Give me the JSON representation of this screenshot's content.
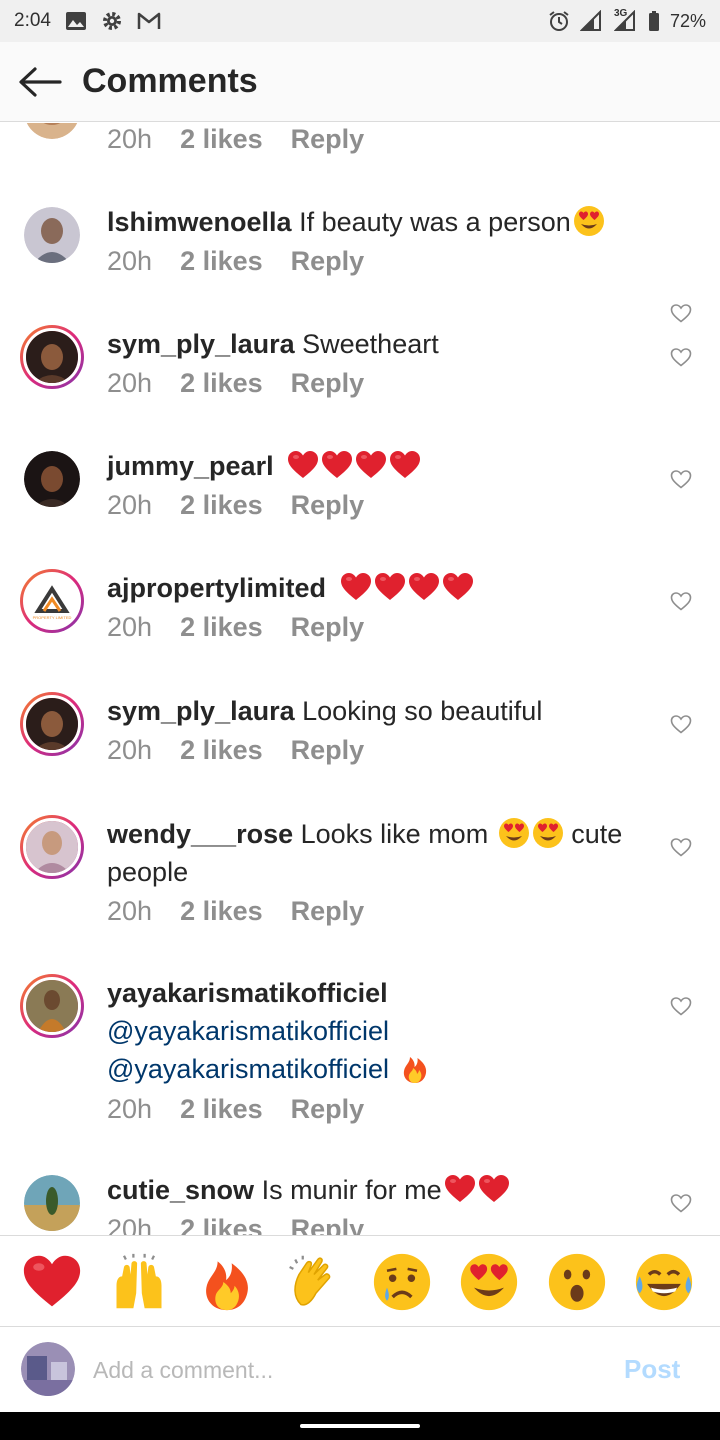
{
  "status_bar": {
    "time": "2:04",
    "network": "3G",
    "battery": "72%"
  },
  "header": {
    "title": "Comments"
  },
  "partial_top": {
    "time": "20h",
    "likes": "2 likes",
    "reply": "Reply"
  },
  "comments": [
    {
      "username": "lshimwenoella",
      "text": "If beauty was a person",
      "time": "20h",
      "likes": "2 likes",
      "reply": "Reply"
    },
    {
      "username": "sym_ply_laura",
      "text": "Sweetheart",
      "time": "20h",
      "likes": "2 likes",
      "reply": "Reply"
    },
    {
      "username": "jummy_pearl",
      "text": "❤️❤️❤️❤️",
      "time": "20h",
      "likes": "2 likes",
      "reply": "Reply"
    },
    {
      "username": "ajpropertylimited",
      "text": "❤️❤️❤️❤️",
      "time": "20h",
      "likes": "2 likes",
      "reply": "Reply"
    },
    {
      "username": "sym_ply_laura",
      "text": "Looking so beautiful",
      "time": "20h",
      "likes": "2 likes",
      "reply": "Reply"
    },
    {
      "username": "wendy___rose",
      "text": "Looks like mom",
      "text2": "cute people",
      "time": "20h",
      "likes": "2 likes",
      "reply": "Reply"
    },
    {
      "username": "yayakarismatikofficiel",
      "mention1": "@yayakarismatikofficiel",
      "mention2": "@yayakarismatikofficiel",
      "time": "20h",
      "likes": "2 likes",
      "reply": "Reply"
    },
    {
      "username": "cutie_snow",
      "text": "Is munir for me",
      "time": "20h",
      "likes": "2 likes",
      "reply": "Reply"
    }
  ],
  "avatar_logo_text": "PROPERTY LIMITED",
  "quick_emojis": [
    "red-heart",
    "raising-hands",
    "fire",
    "clapping-hands",
    "sad-face",
    "heart-eyes",
    "surprised-face",
    "tears-of-joy"
  ],
  "composer": {
    "placeholder": "Add a comment...",
    "post_label": "Post"
  },
  "colors": {
    "accent_post_disabled": "#b3dbff",
    "mention": "#00376b",
    "meta": "#8e8e8e",
    "heart": "#e0212e"
  }
}
